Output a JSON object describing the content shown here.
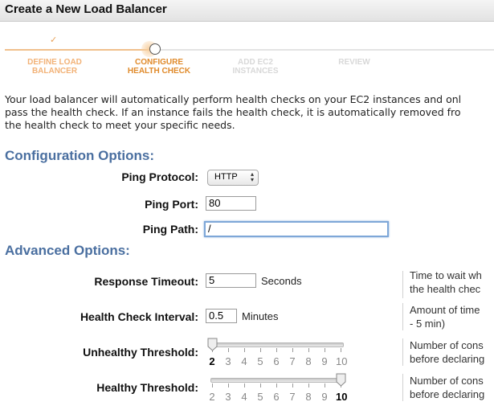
{
  "title": "Create a New Load Balancer",
  "wizard": {
    "steps": [
      "DEFINE LOAD\nBALANCER",
      "CONFIGURE\nHEALTH CHECK",
      "ADD EC2\nINSTANCES",
      "REVIEW"
    ],
    "current_step": 2
  },
  "intro": [
    "Your load balancer will automatically perform health checks on your EC2 instances and onl",
    "pass the health check. If an instance fails the health check, it is automatically removed fro",
    "the health check to meet your specific needs."
  ],
  "config": {
    "heading": "Configuration Options:",
    "ping_protocol_label": "Ping Protocol:",
    "ping_protocol_value": "HTTP",
    "ping_port_label": "Ping Port:",
    "ping_port_value": "80",
    "ping_path_label": "Ping Path:",
    "ping_path_value": "/"
  },
  "advanced": {
    "heading": "Advanced Options:",
    "response_timeout_label": "Response Timeout:",
    "response_timeout_value": "5",
    "response_timeout_unit": "Seconds",
    "response_timeout_hint": [
      "Time to wait wh",
      "the health chec"
    ],
    "interval_label": "Health Check Interval:",
    "interval_value": "0.5",
    "interval_unit": "Minutes",
    "interval_hint": [
      "Amount of time",
      "- 5 min)"
    ],
    "unhealthy_label": "Unhealthy Threshold:",
    "unhealthy_value": 2,
    "unhealthy_hint": [
      "Number of cons",
      "before declaring"
    ],
    "healthy_label": "Healthy Threshold:",
    "healthy_value": 10,
    "healthy_hint": [
      "Number of cons",
      "before declaring"
    ],
    "threshold_options": [
      "2",
      "3",
      "4",
      "5",
      "6",
      "7",
      "8",
      "9",
      "10"
    ]
  },
  "colors": {
    "section_heading": "#4a6fa0",
    "wizard_current": "#e08a2a",
    "wizard_done": "#f2b277",
    "wizard_todo": "#d8d8d8"
  }
}
